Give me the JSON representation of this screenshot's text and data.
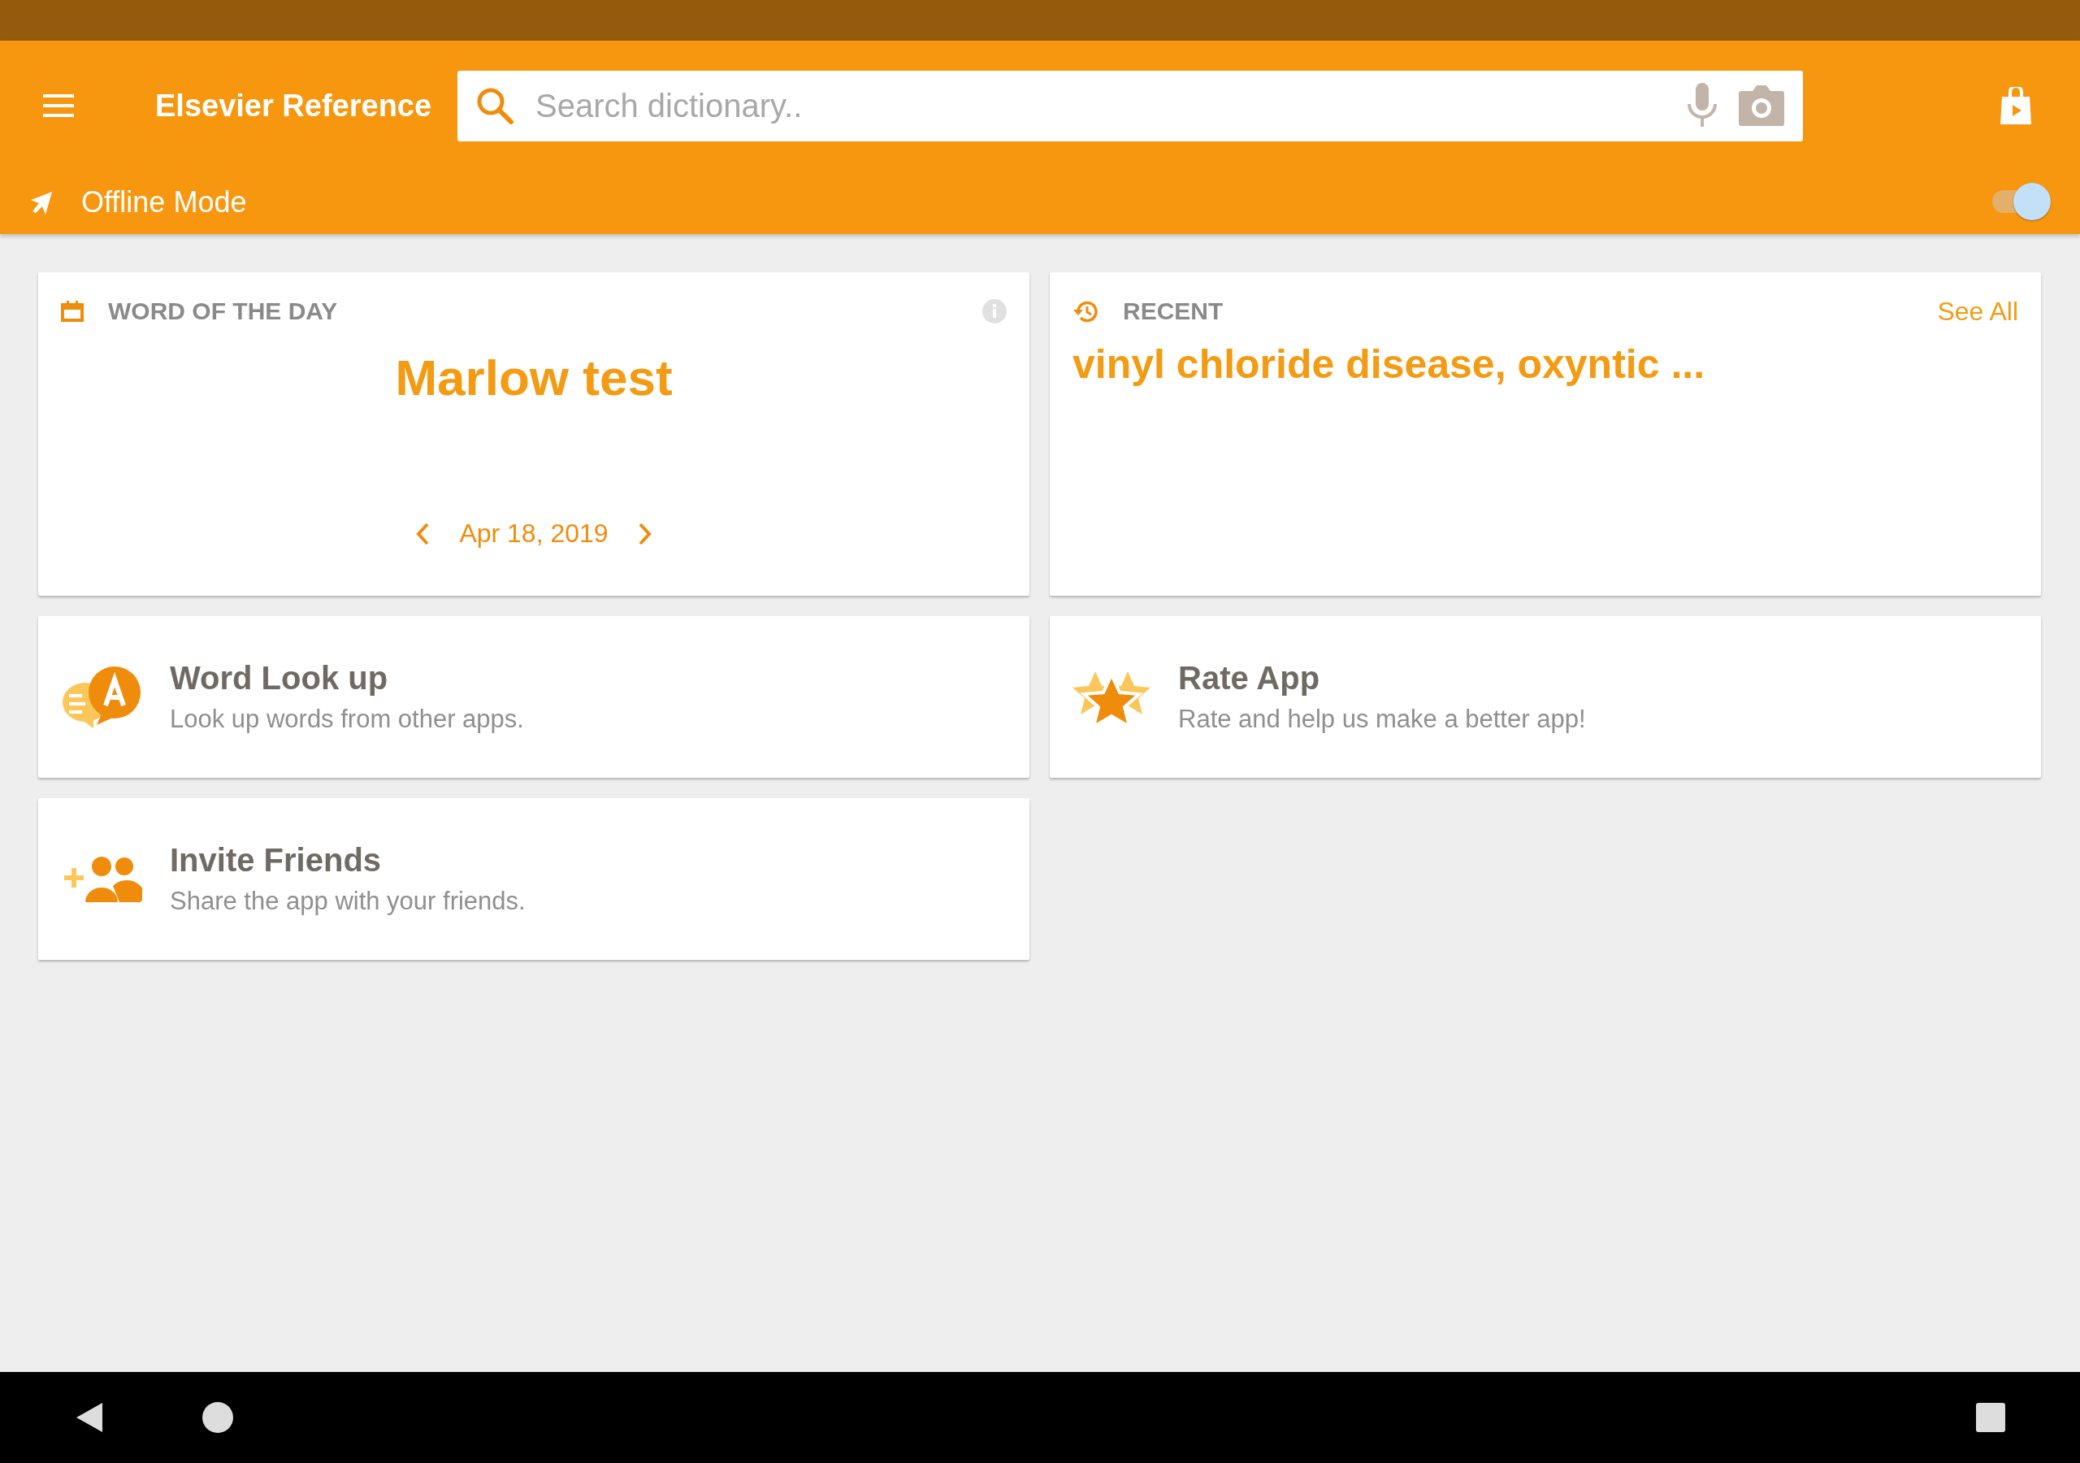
{
  "app_bar": {
    "title": "Elsevier Reference",
    "search": {
      "placeholder": "Search dictionary.."
    }
  },
  "offline_mode": {
    "label": "Offline Mode",
    "on": true
  },
  "word_of_the_day": {
    "heading": "WORD OF THE DAY",
    "word": "Marlow test",
    "date": "Apr 18, 2019"
  },
  "recent": {
    "heading": "RECENT",
    "see_all": "See All",
    "words": "vinyl chloride disease, oxyntic ..."
  },
  "features": [
    {
      "kind": "lookup",
      "title": "Word Look up",
      "subtitle": "Look up words from other apps."
    },
    {
      "kind": "rate",
      "title": "Rate App",
      "subtitle": "Rate and help us make a better app!"
    },
    {
      "kind": "invite",
      "title": "Invite Friends",
      "subtitle": "Share the app with your friends."
    }
  ]
}
